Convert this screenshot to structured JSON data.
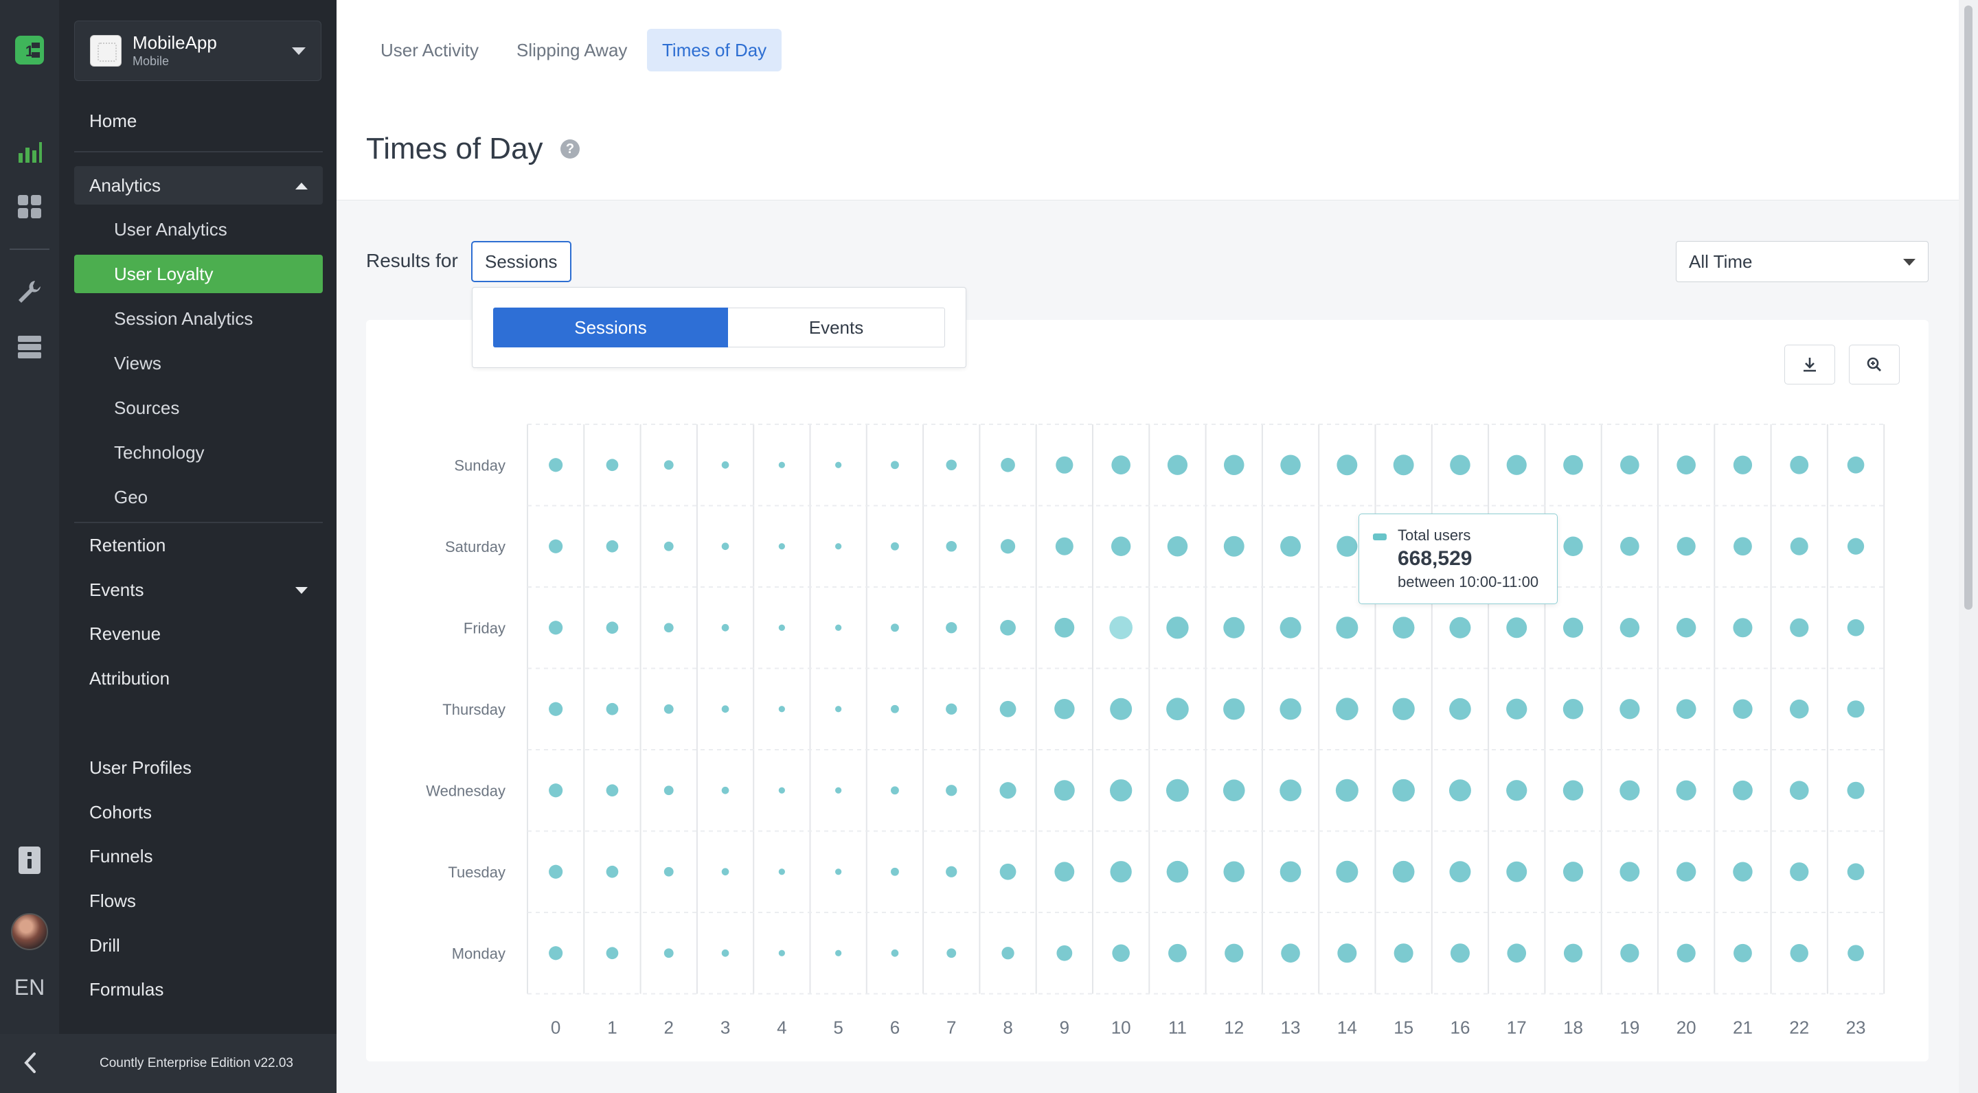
{
  "rail": {
    "icons": [
      "countly-logo-icon",
      "dashboard-chart-icon",
      "apps-grid-icon",
      "wrench-icon",
      "database-icon",
      "document-icon"
    ],
    "language": "EN"
  },
  "app": {
    "name": "MobileApp",
    "type": "Mobile"
  },
  "sidebar": {
    "home": "Home",
    "analytics": "Analytics",
    "analytics_items": [
      "User Analytics",
      "User Loyalty",
      "Session Analytics",
      "Views",
      "Sources",
      "Technology",
      "Geo"
    ],
    "retention": "Retention",
    "events": "Events",
    "revenue": "Revenue",
    "attribution": "Attribution",
    "users_items": [
      "User Profiles",
      "Cohorts",
      "Funnels",
      "Flows",
      "Drill",
      "Formulas"
    ],
    "edition": "Countly Enterprise Edition v22.03"
  },
  "tabs": [
    "User Activity",
    "Slipping Away",
    "Times of Day"
  ],
  "page": {
    "title": "Times of Day",
    "results_for": "Results for",
    "selected_metric": "Sessions",
    "period": "All Time",
    "options": [
      "Sessions",
      "Events"
    ]
  },
  "tooltip": {
    "label": "Total users",
    "value": "668,529",
    "range": "between 10:00-11:00"
  },
  "colors": {
    "accent_green": "#4cae4f",
    "primary_blue": "#2e6fd6",
    "dot": "#7ccad0",
    "dot_highlight": "#9fdde1"
  },
  "chart_data": {
    "type": "scatter",
    "title": "",
    "xlabel": "",
    "ylabel": "",
    "x": [
      0,
      1,
      2,
      3,
      4,
      5,
      6,
      7,
      8,
      9,
      10,
      11,
      12,
      13,
      14,
      15,
      16,
      17,
      18,
      19,
      20,
      21,
      22,
      23
    ],
    "days": [
      "Sunday",
      "Saturday",
      "Friday",
      "Thursday",
      "Wednesday",
      "Tuesday",
      "Monday"
    ],
    "series": [
      {
        "day": "Sunday",
        "values": [
          30,
          22,
          12,
          6,
          4,
          4,
          8,
          16,
          32,
          50,
          62,
          70,
          72,
          72,
          74,
          74,
          72,
          70,
          68,
          62,
          62,
          60,
          58,
          48
        ]
      },
      {
        "day": "Saturday",
        "values": [
          30,
          22,
          12,
          6,
          4,
          4,
          8,
          16,
          34,
          54,
          66,
          72,
          74,
          74,
          76,
          76,
          74,
          70,
          66,
          62,
          60,
          58,
          54,
          46
        ]
      },
      {
        "day": "Friday",
        "values": [
          30,
          22,
          12,
          6,
          4,
          4,
          8,
          18,
          40,
          68,
          84,
          88,
          80,
          80,
          86,
          84,
          80,
          74,
          70,
          66,
          66,
          64,
          60,
          48
        ]
      },
      {
        "day": "Thursday",
        "values": [
          30,
          22,
          12,
          6,
          4,
          4,
          8,
          18,
          44,
          72,
          86,
          90,
          82,
          82,
          90,
          88,
          84,
          76,
          72,
          70,
          68,
          66,
          62,
          50
        ]
      },
      {
        "day": "Wednesday",
        "values": [
          30,
          22,
          12,
          6,
          4,
          4,
          8,
          18,
          46,
          74,
          88,
          92,
          84,
          84,
          92,
          90,
          86,
          76,
          72,
          70,
          70,
          68,
          62,
          50
        ]
      },
      {
        "day": "Tuesday",
        "values": [
          30,
          22,
          12,
          6,
          4,
          4,
          8,
          18,
          44,
          68,
          82,
          84,
          78,
          78,
          86,
          84,
          80,
          74,
          70,
          68,
          66,
          66,
          60,
          48
        ]
      },
      {
        "day": "Monday",
        "values": [
          30,
          22,
          12,
          6,
          4,
          4,
          6,
          12,
          24,
          40,
          52,
          58,
          60,
          62,
          64,
          64,
          64,
          62,
          60,
          60,
          60,
          58,
          56,
          44
        ]
      }
    ],
    "highlight": {
      "day": "Friday",
      "hour": 10
    },
    "grid": true
  }
}
